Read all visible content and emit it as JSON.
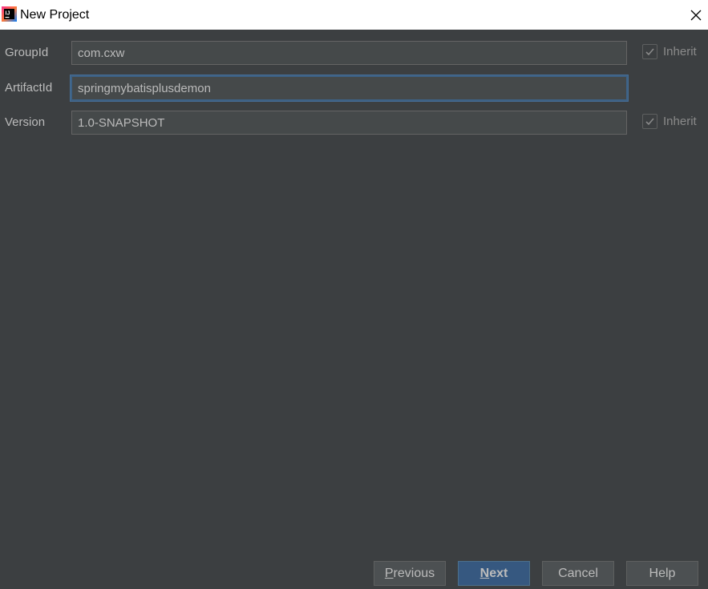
{
  "window": {
    "title": "New Project"
  },
  "form": {
    "group_id": {
      "label": "GroupId",
      "value": "com.cxw",
      "inherit_label": "Inherit",
      "inherit_checked": true
    },
    "artifact_id": {
      "label": "ArtifactId",
      "value": "springmybatisplusdemon"
    },
    "version": {
      "label": "Version",
      "value": "1.0-SNAPSHOT",
      "inherit_label": "Inherit",
      "inherit_checked": true
    }
  },
  "buttons": {
    "previous": {
      "mnemonic": "P",
      "rest": "revious"
    },
    "next": {
      "mnemonic": "N",
      "rest": "ext"
    },
    "cancel": {
      "label": "Cancel"
    },
    "help": {
      "label": "Help"
    }
  },
  "colors": {
    "background": "#3c3f41",
    "primary_button": "#365880",
    "focus_border": "#3d6185"
  }
}
